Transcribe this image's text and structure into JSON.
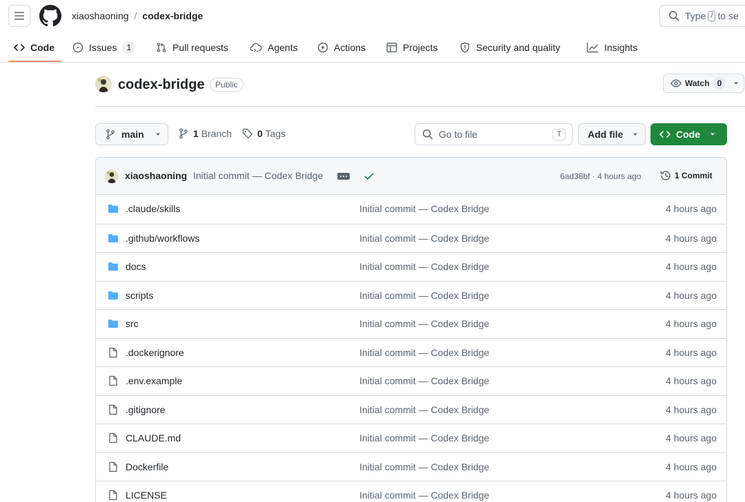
{
  "header": {
    "owner": "xiaoshaoning",
    "separator": "/",
    "repo": "codex-bridge",
    "search": {
      "prefix": "Type",
      "key": "/",
      "suffix": "to se"
    }
  },
  "nav": {
    "tabs": [
      {
        "label": "Code",
        "icon": "code-icon",
        "selected": true
      },
      {
        "label": "Issues",
        "icon": "issue-opened-icon",
        "count": "1"
      },
      {
        "label": "Pull requests",
        "icon": "git-pull-request-icon"
      },
      {
        "label": "Agents",
        "icon": "agent-cloud-icon"
      },
      {
        "label": "Actions",
        "icon": "play-icon"
      },
      {
        "label": "Projects",
        "icon": "table-icon"
      },
      {
        "label": "Security and quality",
        "icon": "shield-icon"
      },
      {
        "label": "Insights",
        "icon": "graph-icon"
      }
    ]
  },
  "repo_header": {
    "name": "codex-bridge",
    "visibility": "Public",
    "watch": {
      "label": "Watch",
      "count": "0"
    }
  },
  "file_nav": {
    "branch": "main",
    "branches": {
      "count": "1",
      "label": "Branch"
    },
    "tags": {
      "count": "0",
      "label": "Tags"
    },
    "goto_placeholder": "Go to file",
    "goto_key": "T",
    "add_file": "Add file",
    "code_button": "Code"
  },
  "latest_commit": {
    "author": "xiaoshaoning",
    "message": "Initial commit — Codex Bridge",
    "sha_time": "6ad38bf · 4 hours ago",
    "commits": "1 Commit"
  },
  "files": [
    {
      "type": "folder",
      "name": ".claude/skills",
      "message": "Initial commit — Codex Bridge",
      "time": "4 hours ago"
    },
    {
      "type": "folder",
      "name": ".github/workflows",
      "message": "Initial commit — Codex Bridge",
      "time": "4 hours ago"
    },
    {
      "type": "folder",
      "name": "docs",
      "message": "Initial commit — Codex Bridge",
      "time": "4 hours ago"
    },
    {
      "type": "folder",
      "name": "scripts",
      "message": "Initial commit — Codex Bridge",
      "time": "4 hours ago"
    },
    {
      "type": "folder",
      "name": "src",
      "message": "Initial commit — Codex Bridge",
      "time": "4 hours ago"
    },
    {
      "type": "file",
      "name": ".dockerignore",
      "message": "Initial commit — Codex Bridge",
      "time": "4 hours ago"
    },
    {
      "type": "file",
      "name": ".env.example",
      "message": "Initial commit — Codex Bridge",
      "time": "4 hours ago"
    },
    {
      "type": "file",
      "name": ".gitignore",
      "message": "Initial commit — Codex Bridge",
      "time": "4 hours ago"
    },
    {
      "type": "file",
      "name": "CLAUDE.md",
      "message": "Initial commit — Codex Bridge",
      "time": "4 hours ago"
    },
    {
      "type": "file",
      "name": "Dockerfile",
      "message": "Initial commit — Codex Bridge",
      "time": "4 hours ago"
    },
    {
      "type": "file",
      "name": "LICENSE",
      "message": "Initial commit — Codex Bridge",
      "time": "4 hours ago"
    }
  ],
  "colors": {
    "folder": "#54aeff",
    "primary_button": "#1f883d",
    "tab_underline": "#fd8c73",
    "success_check": "#1a7f37"
  }
}
